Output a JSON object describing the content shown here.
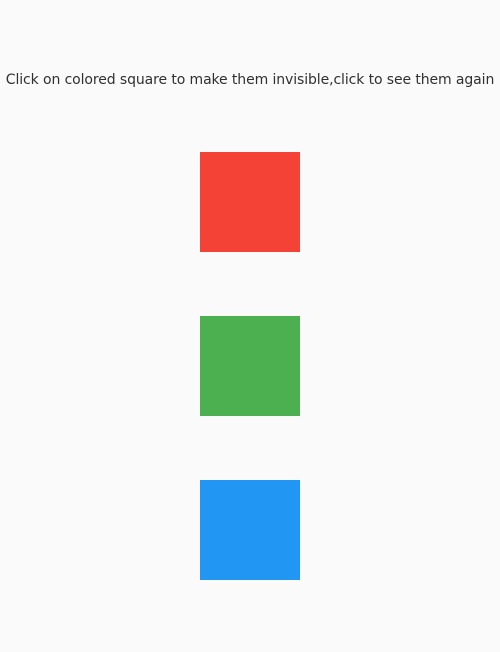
{
  "instruction_text": "Click on colored square to make them invisible,click to see them again",
  "squares": [
    {
      "name": "red-square",
      "color": "#f44336",
      "visible": true
    },
    {
      "name": "green-square",
      "color": "#4caf50",
      "visible": true
    },
    {
      "name": "blue-square",
      "color": "#2196f3",
      "visible": true
    }
  ]
}
